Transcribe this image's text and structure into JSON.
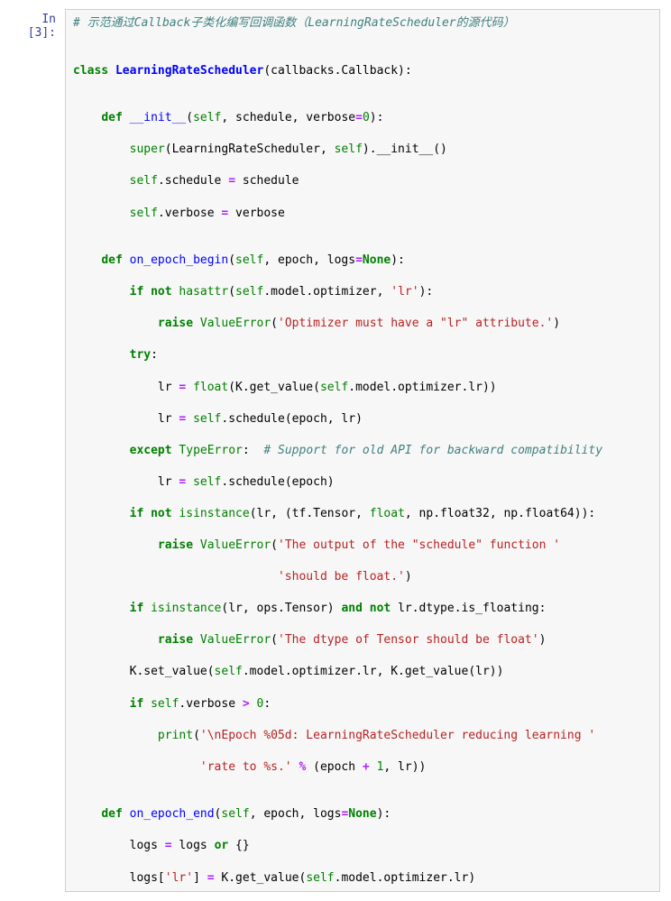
{
  "prompt": "In [3]:",
  "code": {
    "l1": "# 示范通过Callback子类化编写回调函数（LearningRateScheduler的源代码）",
    "l2": "",
    "l3_a": "class",
    "l3_b": "LearningRateScheduler",
    "l3_c": "(callbacks.Callback):",
    "l4": "",
    "l5_a": "def",
    "l5_b": "__init__",
    "l5_c": "(",
    "l5_self": "self",
    "l5_d": ", schedule, verbose",
    "l5_e": "=",
    "l5_num": "0",
    "l5_f": "):",
    "l6_a": "super",
    "l6_b": "(LearningRateScheduler, ",
    "l6_self": "self",
    "l6_c": ").__init__()",
    "l7_self": "self",
    "l7_a": ".schedule ",
    "l7_b": "=",
    "l7_c": " schedule",
    "l8_self": "self",
    "l8_a": ".verbose ",
    "l8_b": "=",
    "l8_c": " verbose",
    "l9": "",
    "l10_a": "def",
    "l10_b": "on_epoch_begin",
    "l10_c": "(",
    "l10_self": "self",
    "l10_d": ", epoch, logs",
    "l10_e": "=",
    "l10_none": "None",
    "l10_f": "):",
    "l11_a": "if",
    "l11_b": "not",
    "l11_c": "hasattr",
    "l11_d": "(",
    "l11_self": "self",
    "l11_e": ".model.optimizer, ",
    "l11_str": "'lr'",
    "l11_f": "):",
    "l12_a": "raise",
    "l12_b": "ValueError",
    "l12_c": "(",
    "l12_str": "'Optimizer must have a \"lr\" attribute.'",
    "l12_d": ")",
    "l13_a": "try",
    "l13_b": ":",
    "l14_a": "lr ",
    "l14_b": "=",
    "l14_c": " ",
    "l14_d": "float",
    "l14_e": "(K.get_value(",
    "l14_self": "self",
    "l14_f": ".model.optimizer.lr))",
    "l15_a": "lr ",
    "l15_b": "=",
    "l15_c": " ",
    "l15_self": "self",
    "l15_d": ".schedule(epoch, lr)",
    "l16_a": "except",
    "l16_b": "TypeError",
    "l16_c": ":  ",
    "l16_cm": "# Support for old API for backward compatibility",
    "l17_a": "lr ",
    "l17_b": "=",
    "l17_c": " ",
    "l17_self": "self",
    "l17_d": ".schedule(epoch)",
    "l18_a": "if",
    "l18_b": "not",
    "l18_c": "isinstance",
    "l18_d": "(lr, (tf.Tensor, ",
    "l18_e": "float",
    "l18_f": ", np.float32, np.float64)):",
    "l19_a": "raise",
    "l19_b": "ValueError",
    "l19_c": "(",
    "l19_str": "'The output of the \"schedule\" function '",
    "l20_str": "'should be float.'",
    "l20_b": ")",
    "l21_a": "if",
    "l21_b": "isinstance",
    "l21_c": "(lr, ops.Tensor) ",
    "l21_d": "and",
    "l21_e": "not",
    "l21_f": " lr.dtype.is_floating:",
    "l22_a": "raise",
    "l22_b": "ValueError",
    "l22_c": "(",
    "l22_str": "'The dtype of Tensor should be float'",
    "l22_d": ")",
    "l23_a": "K.set_value(",
    "l23_self": "self",
    "l23_b": ".model.optimizer.lr, K.get_value(lr))",
    "l24_a": "if",
    "l24_self": "self",
    "l24_b": ".verbose ",
    "l24_c": ">",
    "l24_d": " ",
    "l24_num": "0",
    "l24_e": ":",
    "l25_a": "print",
    "l25_b": "(",
    "l25_str": "'\\nEpoch %05d: LearningRateScheduler reducing learning '",
    "l26_str": "'rate to %s.'",
    "l26_b": " ",
    "l26_c": "%",
    "l26_d": " (epoch ",
    "l26_e": "+",
    "l26_f": " ",
    "l26_num": "1",
    "l26_g": ", lr))",
    "l27": "",
    "l28_a": "def",
    "l28_b": "on_epoch_end",
    "l28_c": "(",
    "l28_self": "self",
    "l28_d": ", epoch, logs",
    "l28_e": "=",
    "l28_none": "None",
    "l28_f": "):",
    "l29_a": "logs ",
    "l29_b": "=",
    "l29_c": " logs ",
    "l29_d": "or",
    "l29_e": " {}",
    "l30_a": "logs[",
    "l30_str": "'lr'",
    "l30_b": "] ",
    "l30_c": "=",
    "l30_d": " K.get_value(",
    "l30_self": "self",
    "l30_e": ".model.optimizer.lr)"
  }
}
